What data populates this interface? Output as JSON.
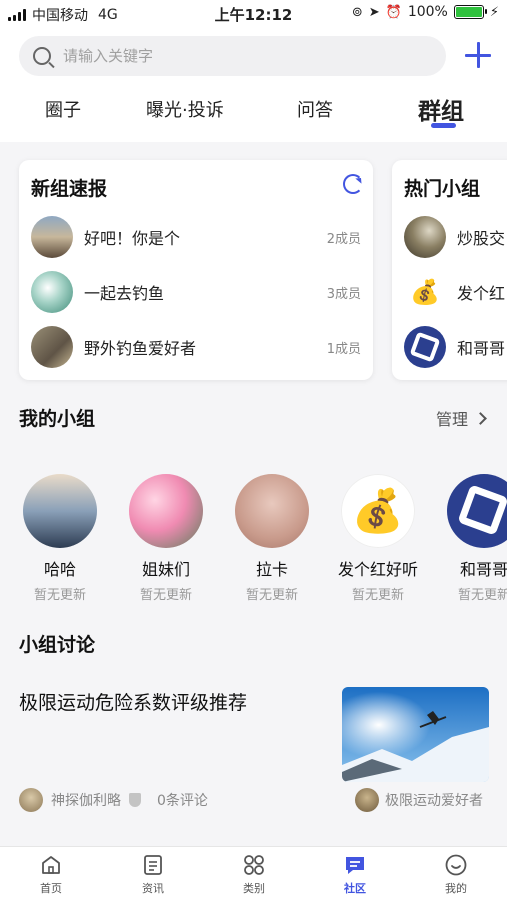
{
  "status_bar": {
    "carrier": "中国移动",
    "network": "4G",
    "time": "上午12:12",
    "battery": "100%"
  },
  "search": {
    "placeholder": "请输入关键字"
  },
  "tabs": [
    {
      "label": "圈子"
    },
    {
      "label": "曝光·投诉"
    },
    {
      "label": "问答"
    },
    {
      "label": "群组",
      "active": true
    }
  ],
  "new_groups": {
    "title": "新组速报",
    "items": [
      {
        "name": "好吧！你是个",
        "count": "2成员"
      },
      {
        "name": "一起去钓鱼",
        "count": "3成员"
      },
      {
        "name": "野外钓鱼爱好者",
        "count": "1成员"
      }
    ]
  },
  "hot_groups": {
    "title": "热门小组",
    "items": [
      {
        "name": "炒股交"
      },
      {
        "name": "发个红"
      },
      {
        "name": "和哥哥"
      }
    ]
  },
  "my_groups": {
    "title": "我的小组",
    "manage_label": "管理",
    "items": [
      {
        "name": "哈哈",
        "status": "暂无更新"
      },
      {
        "name": "姐妹们",
        "status": "暂无更新"
      },
      {
        "name": "拉卡",
        "status": "暂无更新"
      },
      {
        "name": "发个红好听",
        "status": "暂无更新"
      },
      {
        "name": "和哥哥",
        "status": "暂无更新"
      }
    ]
  },
  "discussion": {
    "title": "小组讨论",
    "post": {
      "title": "极限运动危险系数评级推荐",
      "author": "神探伽利略",
      "comments": "0条评论",
      "group": "极限运动爱好者"
    }
  },
  "bottom_nav": [
    {
      "label": "首页",
      "icon": "home-icon"
    },
    {
      "label": "资讯",
      "icon": "news-icon"
    },
    {
      "label": "类别",
      "icon": "category-icon"
    },
    {
      "label": "社区",
      "icon": "community-icon",
      "active": true
    },
    {
      "label": "我的",
      "icon": "profile-icon"
    }
  ],
  "colors": {
    "accent": "#4255e0",
    "background": "#f5f5f7"
  }
}
